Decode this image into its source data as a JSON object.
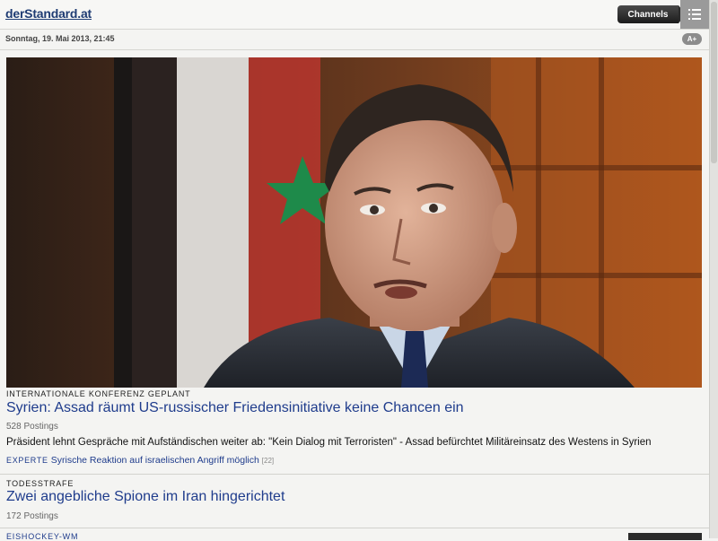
{
  "header": {
    "logo": "derStandard.at",
    "channels_label": "Channels"
  },
  "datebar": {
    "date": "Sonntag, 19. Mai 2013, 21:45",
    "font_size_label": "A+"
  },
  "articles": [
    {
      "kicker": "INTERNATIONALE KONFERENZ GEPLANT",
      "headline": "Syrien: Assad räumt US-russischer Friedensinitiative keine Chancen ein",
      "postings": "528 Postings",
      "summary": "Präsident lehnt Gespräche mit Aufständischen weiter ab: \"Kein Dialog mit Terroristen\" - Assad befürchtet Militäreinsatz des Westens in Syrien",
      "related_tag": "EXPERTE",
      "related_text": "Syrische Reaktion auf israelischen Angriff möglich",
      "related_count": "[22]"
    },
    {
      "kicker": "TODESSTRAFE",
      "headline": "Zwei angebliche Spione im Iran hingerichtet",
      "postings": "172 Postings"
    },
    {
      "kicker": "EISHOCKEY-WM"
    }
  ],
  "icons": {
    "menu": "list-menu-icon"
  }
}
